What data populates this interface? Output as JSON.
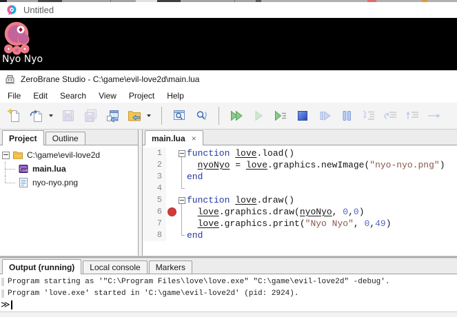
{
  "love_window": {
    "icon": "love-balloon-icon",
    "title": "Untitled",
    "canvas_label": "Nyo Nyo"
  },
  "ide": {
    "icon": "zerobrane-icon",
    "title": "ZeroBrane Studio - C:\\game\\evil-love2d\\main.lua",
    "menu": [
      "File",
      "Edit",
      "Search",
      "View",
      "Project",
      "Help"
    ],
    "toolbar": [
      {
        "name": "new-file"
      },
      {
        "name": "open-file",
        "dropdown": true
      },
      {
        "name": "save",
        "disabled": true
      },
      {
        "name": "save-all",
        "disabled": true
      },
      {
        "name": "project-from-file"
      },
      {
        "name": "project-directory",
        "dropdown": true
      },
      {
        "name": "sep"
      },
      {
        "name": "find"
      },
      {
        "name": "find-and-replace"
      },
      {
        "name": "sep"
      },
      {
        "name": "run"
      },
      {
        "name": "start-debugging",
        "disabled": true
      },
      {
        "name": "run-to-cursor"
      },
      {
        "name": "stop-process"
      },
      {
        "name": "detach-process",
        "disabled": true
      },
      {
        "name": "break-process"
      },
      {
        "name": "step-into",
        "disabled": true
      },
      {
        "name": "step-over",
        "disabled": true
      },
      {
        "name": "step-out",
        "disabled": true
      },
      {
        "name": "trace",
        "disabled": true
      }
    ],
    "project_panel": {
      "tabs": [
        {
          "label": "Project",
          "active": true
        },
        {
          "label": "Outline",
          "active": false
        }
      ],
      "tree": [
        {
          "icon": "folder-icon",
          "label": "C:\\game\\evil-love2d",
          "level": 0,
          "expander": "minus",
          "bold": false
        },
        {
          "icon": "lua-file-icon",
          "label": "main.lua",
          "level": 1,
          "bold": true
        },
        {
          "icon": "png-file-icon",
          "label": "nyo-nyo.png",
          "level": 1,
          "bold": false
        }
      ]
    },
    "editor": {
      "tabs": [
        {
          "label": "main.lua",
          "active": true,
          "close": "×"
        }
      ],
      "breakpoint_line": 6,
      "lines": [
        {
          "n": "1",
          "fold": "start",
          "parts": [
            [
              "kw",
              "function "
            ],
            [
              "gl",
              "love"
            ],
            [
              "pl",
              ".load()"
            ]
          ]
        },
        {
          "n": "2",
          "fold": "mid",
          "parts": [
            [
              "pl",
              "  "
            ],
            [
              "gl",
              "nyoNyo"
            ],
            [
              "pl",
              " = "
            ],
            [
              "gl",
              "love"
            ],
            [
              "pl",
              ".graphics.newImage("
            ],
            [
              "str",
              "\"nyo-nyo.png\""
            ],
            [
              "pl",
              ")"
            ]
          ]
        },
        {
          "n": "3",
          "fold": "mid",
          "parts": [
            [
              "kw",
              "end"
            ]
          ]
        },
        {
          "n": "4",
          "fold": "end",
          "parts": []
        },
        {
          "n": "5",
          "fold": "start",
          "parts": [
            [
              "kw",
              "function "
            ],
            [
              "gl",
              "love"
            ],
            [
              "pl",
              ".draw()"
            ]
          ]
        },
        {
          "n": "6",
          "fold": "mid",
          "bp": true,
          "parts": [
            [
              "pl",
              "  "
            ],
            [
              "gl",
              "love"
            ],
            [
              "pl",
              ".graphics.draw("
            ],
            [
              "gl",
              "nyoNyo"
            ],
            [
              "pl",
              ", "
            ],
            [
              "num",
              "0"
            ],
            [
              "pl",
              ","
            ],
            [
              "num",
              "0"
            ],
            [
              "pl",
              ")"
            ]
          ]
        },
        {
          "n": "7",
          "fold": "mid",
          "parts": [
            [
              "pl",
              "  "
            ],
            [
              "gl",
              "love"
            ],
            [
              "pl",
              ".graphics.print("
            ],
            [
              "str",
              "\"Nyo Nyo\""
            ],
            [
              "pl",
              ", "
            ],
            [
              "num",
              "0"
            ],
            [
              "pl",
              ","
            ],
            [
              "num",
              "49"
            ],
            [
              "pl",
              ")"
            ]
          ]
        },
        {
          "n": "8",
          "fold": "end",
          "parts": [
            [
              "kw",
              "end"
            ]
          ]
        }
      ]
    },
    "output_panel": {
      "tabs": [
        {
          "label": "Output (running)",
          "active": true
        },
        {
          "label": "Local console",
          "active": false
        },
        {
          "label": "Markers",
          "active": false
        }
      ],
      "lines": [
        "Program starting as '\"C:\\Program Files\\love\\love.exe\" \"C:\\game\\evil-love2d\" -debug'.",
        "Program 'love.exe' started in 'C:\\game\\evil-love2d' (pid: 2924)."
      ],
      "prompt": "≫"
    }
  },
  "colors": {
    "keyword": "#2637a4",
    "string": "#8a564c",
    "number": "#4f68c8",
    "breakpoint": "#d23b3b",
    "fold_line": "#b3a3d3",
    "game_bg": "#000000",
    "sprite_body": "#c2639c",
    "sprite_outline": "#ee7d85",
    "love_pink": "#e75a9d",
    "love_blue": "#28a7df"
  }
}
